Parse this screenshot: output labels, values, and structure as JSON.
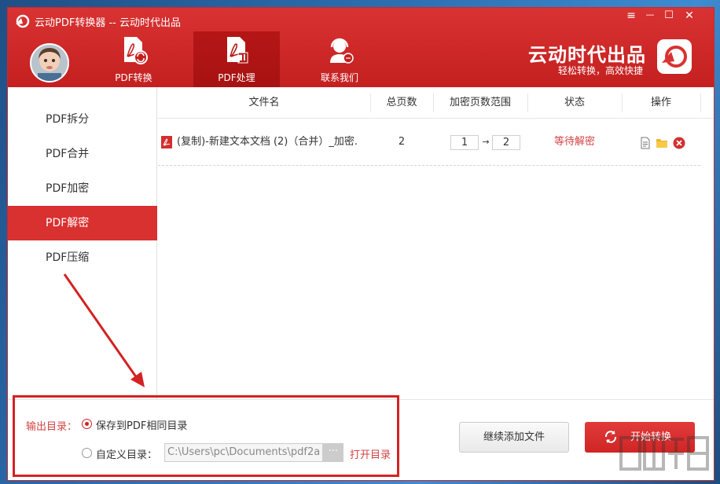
{
  "window": {
    "title": "云动PDF转换器 -- 云动时代出品"
  },
  "window_controls": {
    "menu": "≡",
    "minimize": "—",
    "maximize": "☐",
    "close": "✕"
  },
  "nav": [
    {
      "label": "PDF转换",
      "icon": "pdf-convert-icon"
    },
    {
      "label": "PDF处理",
      "icon": "pdf-process-icon",
      "active": true
    },
    {
      "label": "联系我们",
      "icon": "support-headset-icon"
    }
  ],
  "brand": {
    "name": "云动时代出品",
    "slogan": "轻松转换，高效快捷"
  },
  "sidebar": {
    "items": [
      {
        "label": "PDF拆分"
      },
      {
        "label": "PDF合并"
      },
      {
        "label": "PDF加密"
      },
      {
        "label": "PDF解密",
        "active": true
      },
      {
        "label": "PDF压缩"
      }
    ]
  },
  "table": {
    "headers": [
      "文件名",
      "总页数",
      "加密页数范围",
      "状态",
      "操作"
    ],
    "rows": [
      {
        "filename": "(复制)-新建文本文档 (2)（合并）_加密.",
        "pages": "2",
        "range_from": "1",
        "range_to": "2",
        "status": "等待解密"
      }
    ]
  },
  "footer": {
    "output_label": "输出目录：",
    "option_same": "保存到PDF相同目录",
    "option_custom": "自定义目录：",
    "custom_path": "C:\\Users\\pc\\Documents\\pdf2a",
    "browse": "···",
    "open_dir": "打开目录",
    "add_more": "继续添加文件",
    "start": "开始转换"
  },
  "colors": {
    "brand_red": "#d93232",
    "status_red": "#d34343"
  }
}
